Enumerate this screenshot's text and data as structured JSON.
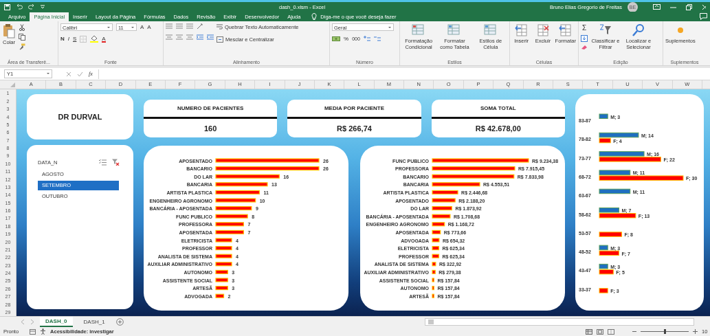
{
  "title_bar": {
    "title": "dash_0.xlsm  -  Excel",
    "user": "Bruno Elias Gregorio de Freitas",
    "initials": "BE"
  },
  "tabs": [
    {
      "label": "Arquivo",
      "selected": false
    },
    {
      "label": "Página Inicial",
      "selected": true
    },
    {
      "label": "Inserir",
      "selected": false
    },
    {
      "label": "Layout da Página",
      "selected": false
    },
    {
      "label": "Fórmulas",
      "selected": false
    },
    {
      "label": "Dados",
      "selected": false
    },
    {
      "label": "Revisão",
      "selected": false
    },
    {
      "label": "Exibir",
      "selected": false
    },
    {
      "label": "Desenvolvedor",
      "selected": false
    },
    {
      "label": "Ajuda",
      "selected": false
    }
  ],
  "tell_me": "Diga-me o que você deseja fazer",
  "ribbon": {
    "clipboard": {
      "paste": "Colar",
      "group": "Área de Transferê..."
    },
    "font": {
      "family": "Calibri",
      "size": "11",
      "grow": "A",
      "shrink": "A",
      "bold": "N",
      "italic": "I",
      "underline": "S",
      "font_color_button": "A",
      "group": "Fonte"
    },
    "alignment": {
      "wrap": "Quebrar Texto Automaticamente",
      "merge": "Mesclar e Centralizar",
      "group": "Alinhamento"
    },
    "number": {
      "format": "Geral",
      "percent": "%",
      "thousands": "000",
      "group": "Número"
    },
    "styles": {
      "buttons": [
        "Formatação Condicional",
        "Formatar como Tabela",
        "Estilos de Célula"
      ],
      "group": "Estilos"
    },
    "cells": {
      "buttons": [
        "Inserir",
        "Excluir",
        "Formatar"
      ],
      "group": "Células"
    },
    "editing": {
      "sum": "Σ",
      "buttons": [
        "Classificar e Filtrar",
        "Localizar e Selecionar"
      ],
      "group": "Edição"
    },
    "addins": {
      "buttons": [
        "Suplementos"
      ],
      "group": "Suplementos"
    }
  },
  "formula_bar": {
    "name_box": "Y1",
    "fx": "fx"
  },
  "columns": [
    "A",
    "B",
    "C",
    "D",
    "E",
    "F",
    "G",
    "H",
    "I",
    "J",
    "K",
    "L",
    "M",
    "N",
    "O",
    "P",
    "Q",
    "R",
    "S",
    "T",
    "U",
    "V",
    "W"
  ],
  "rows": [
    "1",
    "2",
    "3",
    "4",
    "5",
    "6",
    "7",
    "8",
    "9",
    "10",
    "11",
    "12",
    "13",
    "14",
    "15",
    "16",
    "17",
    "18",
    "19",
    "20",
    "21",
    "22",
    "23",
    "24",
    "25",
    "26",
    "27",
    "28",
    "29"
  ],
  "dashboard": {
    "title": "DR DURVAL",
    "kpis": [
      {
        "title": "NUMERO DE PACIENTES",
        "value": "160"
      },
      {
        "title": "MEDIA POR PACIENTE",
        "value": "R$ 266,74"
      },
      {
        "title": "SOMA TOTAL",
        "value": "R$ 42.678,00"
      }
    ],
    "slicer": {
      "title": "DATA_N",
      "items": [
        {
          "label": "AGOSTO",
          "selected": false
        },
        {
          "label": "SETEMBRO",
          "selected": true
        },
        {
          "label": "OUTUBRO",
          "selected": false
        }
      ]
    },
    "count_chart": {
      "chart_data": {
        "type": "bar",
        "orientation": "horizontal",
        "data_labels": true,
        "categories": [
          "APOSENTADO",
          "BANCARIO",
          "DO LAR",
          "BANCARIA",
          "ARTISTA PLASTICA",
          "ENGENHEIRO AGRONOMO",
          "BANCÁRIA - APOSENTADA",
          "FUNC PUBLICO",
          "PROFESSORA",
          "APOSENTADA",
          "ELETRICISTA",
          "PROFESSOR",
          "ANALISTA DE SISTEMA",
          "AUXILIAR ADMINISTRATIVO",
          "AUTONOMO",
          "ASSISTENTE SOCIAL",
          "ARTESÃ",
          "ADVOGADA"
        ],
        "values": [
          26,
          26,
          16,
          13,
          11,
          10,
          9,
          8,
          7,
          7,
          4,
          4,
          4,
          4,
          3,
          3,
          3,
          2
        ]
      }
    },
    "sum_chart": {
      "chart_data": {
        "type": "bar",
        "orientation": "horizontal",
        "value_labels": [
          "R$ 9.234,38",
          "R$ 7.915,45",
          "R$ 7.833,98",
          "R$ 4.553,51",
          "R$ 2.446,68",
          "R$ 2.188,20",
          "R$ 1.873,92",
          "R$ 1.708,68",
          "R$ 1.168,72",
          "R$ 773,66",
          "R$ 654,32",
          "R$ 625,34",
          "R$ 625,34",
          "R$ 322,92",
          "R$ 279,38",
          "R$ 157,84",
          "R$ 157,84",
          "R$ 157,84"
        ],
        "categories": [
          "FUNC PUBLICO",
          "PROFESSORA",
          "BANCARIO",
          "BANCARIA",
          "ARTISTA PLASTICA",
          "APOSENTADO",
          "DO LAR",
          "BANCÁRIA - APOSENTADA",
          "ENGENHEIRO AGRONOMO",
          "APOSENTADA",
          "ADVOGADA",
          "ELETRICISTA",
          "PROFESSOR",
          "ANALISTA DE SISTEMA",
          "AUXILIAR ADMINISTRATIVO",
          "ASSISTENTE SOCIAL",
          "AUTONOMO",
          "ARTESÃ"
        ],
        "values": [
          9234.38,
          7915.45,
          7833.98,
          4553.51,
          2446.68,
          2188.2,
          1873.92,
          1708.68,
          1168.72,
          773.66,
          654.32,
          625.34,
          625.34,
          322.92,
          279.38,
          157.84,
          157.84,
          157.84
        ]
      }
    },
    "age_chart": {
      "chart_data": {
        "type": "bar",
        "orientation": "horizontal",
        "categories": [
          "83-87",
          "78-82",
          "73-77",
          "68-72",
          "63-67",
          "58-62",
          "53-57",
          "48-52",
          "43-47",
          "33-37"
        ],
        "series": [
          {
            "color": "#1f6fc0",
            "values": [
              3,
              14,
              16,
              11,
              11,
              7,
              null,
              3,
              3,
              null
            ],
            "value_labels": [
              "M; 3",
              "M; 14",
              "M; 16",
              "M; 11",
              "M; 11",
              "M; 7",
              null,
              "M; 3",
              "M; 3",
              null
            ]
          },
          {
            "color": "#ff0000",
            "values": [
              null,
              4,
              22,
              30,
              null,
              13,
              8,
              7,
              5,
              3
            ],
            "value_labels": [
              null,
              "F; 4",
              "F; 22",
              "F; 30",
              null,
              "F; 13",
              "F; 8",
              "F; 7",
              "F; 5",
              "F; 3"
            ]
          }
        ]
      }
    }
  },
  "sheet_tabs": [
    {
      "label": "DASH_0",
      "selected": true
    },
    {
      "label": "DASH_1",
      "selected": false
    }
  ],
  "status_bar": {
    "ready": "Pronto",
    "accessibility": "Acessibilidade: investigar",
    "zoom": "10",
    "zoom_slider": {
      "level": 0.5
    }
  }
}
